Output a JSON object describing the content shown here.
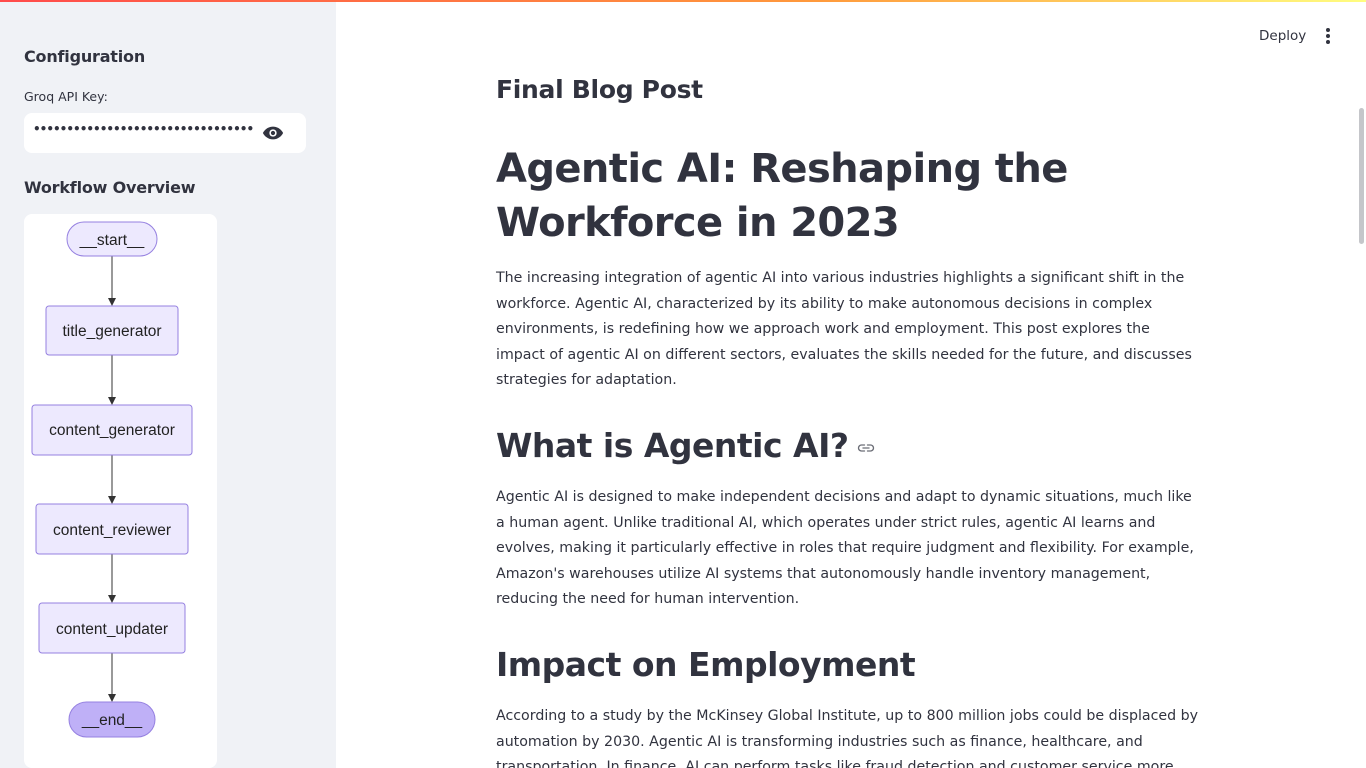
{
  "sidebar": {
    "title": "Configuration",
    "api_key_label": "Groq API Key:",
    "api_key_value": "•••••••••••••••••••••••••••••••••••••••••••",
    "workflow_title": "Workflow Overview",
    "nodes": [
      "__start__",
      "title_generator",
      "content_generator",
      "content_reviewer",
      "content_updater",
      "__end__"
    ]
  },
  "header": {
    "deploy_label": "Deploy"
  },
  "main": {
    "section_title": "Final Blog Post",
    "post_title": "Agentic AI: Reshaping the Workforce in 2023",
    "intro": "The increasing integration of agentic AI into various industries highlights a significant shift in the workforce. Agentic AI, characterized by its ability to make autonomous decisions in complex environments, is redefining how we approach work and employment. This post explores the impact of agentic AI on different sectors, evaluates the skills needed for the future, and discusses strategies for adaptation.",
    "h2_what": "What is Agentic AI?",
    "para_what": "Agentic AI is designed to make independent decisions and adapt to dynamic situations, much like a human agent. Unlike traditional AI, which operates under strict rules, agentic AI learns and evolves, making it particularly effective in roles that require judgment and flexibility. For example, Amazon's warehouses utilize AI systems that autonomously handle inventory management, reducing the need for human intervention.",
    "h2_impact": "Impact on Employment",
    "para_impact": "According to a study by the McKinsey Global Institute, up to 800 million jobs could be displaced by automation by 2030. Agentic AI is transforming industries such as finance, healthcare, and transportation. In finance, AI can perform tasks like fraud detection and customer service more efficiently than humans."
  },
  "colors": {
    "node_fill": "#ede9fe",
    "node_stroke": "#9580e0",
    "end_fill": "#bfb0f7",
    "text": "#31333f"
  },
  "icons": {
    "password_toggle": "eye-icon",
    "menu": "kebab-menu-icon",
    "anchor": "link-icon"
  }
}
